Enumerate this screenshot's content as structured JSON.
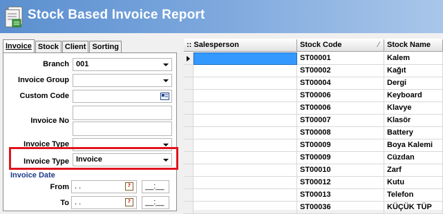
{
  "window": {
    "title": "Stock Based Invoice Report"
  },
  "tabs": [
    "Invoice",
    "Stock",
    "Client",
    "Sorting"
  ],
  "filters": {
    "branch": {
      "label": "Branch",
      "value": "001"
    },
    "invoice_group": {
      "label": "Invoice Group",
      "value": ""
    },
    "custom_code": {
      "label": "Custom Code",
      "value": ""
    },
    "invoice_no": {
      "label": "Invoice No",
      "value": ""
    },
    "invoice_type_1": {
      "label": "Invoice Type",
      "value": ""
    },
    "invoice_type_2": {
      "label": "Invoice Type",
      "value": "Invoice"
    }
  },
  "invoice_date": {
    "section_label": "Invoice Date",
    "from_label": "From",
    "to_label": "To",
    "from_date": ". .",
    "to_date": ". .",
    "from_time": "__:__",
    "to_time": "__:__"
  },
  "grid": {
    "columns": [
      ":: Salesperson",
      "Stock Code",
      "Stock Name"
    ],
    "rows": [
      {
        "salesperson": "",
        "code": "ST00001",
        "name": "Kalem"
      },
      {
        "salesperson": "",
        "code": "ST00002",
        "name": "Kağıt"
      },
      {
        "salesperson": "",
        "code": "ST00004",
        "name": "Dergi"
      },
      {
        "salesperson": "",
        "code": "ST00006",
        "name": "Keyboard"
      },
      {
        "salesperson": "",
        "code": "ST00006",
        "name": "Klavye"
      },
      {
        "salesperson": "",
        "code": "ST00007",
        "name": "Klasör"
      },
      {
        "salesperson": "",
        "code": "ST00008",
        "name": "Battery"
      },
      {
        "salesperson": "",
        "code": "ST00009",
        "name": "Boya Kalemi"
      },
      {
        "salesperson": "",
        "code": "ST00009",
        "name": "Cüzdan"
      },
      {
        "salesperson": "",
        "code": "ST00010",
        "name": "Zarf"
      },
      {
        "salesperson": "",
        "code": "ST00012",
        "name": "Kutu"
      },
      {
        "salesperson": "",
        "code": "ST00013",
        "name": "Telefon"
      },
      {
        "salesperson": "",
        "code": "ST00036",
        "name": "KÜÇÜK TÜP"
      }
    ]
  },
  "colors": {
    "title_bar": "#5b8fcf",
    "highlight": "#e0141e",
    "selection": "#3399ff"
  }
}
